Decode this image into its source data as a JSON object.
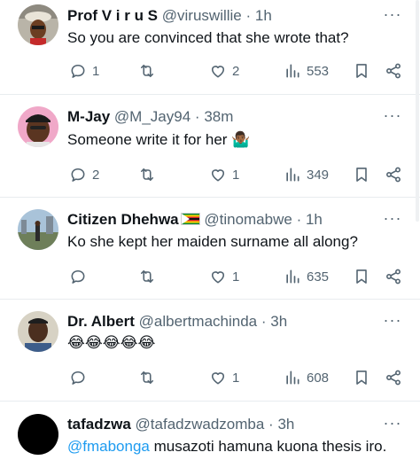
{
  "tweets": [
    {
      "name": "Prof V i r u S",
      "handle": "@viruswillie",
      "separator": "·",
      "time": "1h",
      "text": "So you are convinced that she wrote that?",
      "replies": "1",
      "retweets": "",
      "likes": "2",
      "views": "553"
    },
    {
      "name": "M-Jay",
      "handle": "@M_Jay94",
      "separator": "·",
      "time": "38m",
      "text": "Someone write it for her ",
      "emoji": "🤷🏾‍♂️",
      "replies": "2",
      "retweets": "",
      "likes": "1",
      "views": "349"
    },
    {
      "name": "Citizen Dhehwa",
      "handle": "@tinomabwe",
      "separator": "·",
      "time": "1h",
      "text": "Ko she kept her maiden surname all along?",
      "replies": "",
      "retweets": "",
      "likes": "1",
      "views": "635"
    },
    {
      "name": "Dr. Albert",
      "handle": "@albertmachinda",
      "separator": "·",
      "time": "3h",
      "text": "😂😂😂😂😂",
      "replies": "",
      "retweets": "",
      "likes": "1",
      "views": "608"
    },
    {
      "name": "tafadzwa",
      "handle": "@tafadzwadzomba",
      "separator": "·",
      "time": "3h",
      "mention": "@fmabonga",
      "text": " musazoti hamuna kuona thesis iro."
    }
  ],
  "more_label": "···",
  "colors": {
    "text": "#0f1419",
    "secondary": "#536471",
    "link": "#1d9bf0",
    "divider": "#e8ecef"
  },
  "icons": [
    "reply-icon",
    "retweet-icon",
    "like-icon",
    "views-icon",
    "bookmark-icon",
    "share-icon",
    "more-icon"
  ]
}
